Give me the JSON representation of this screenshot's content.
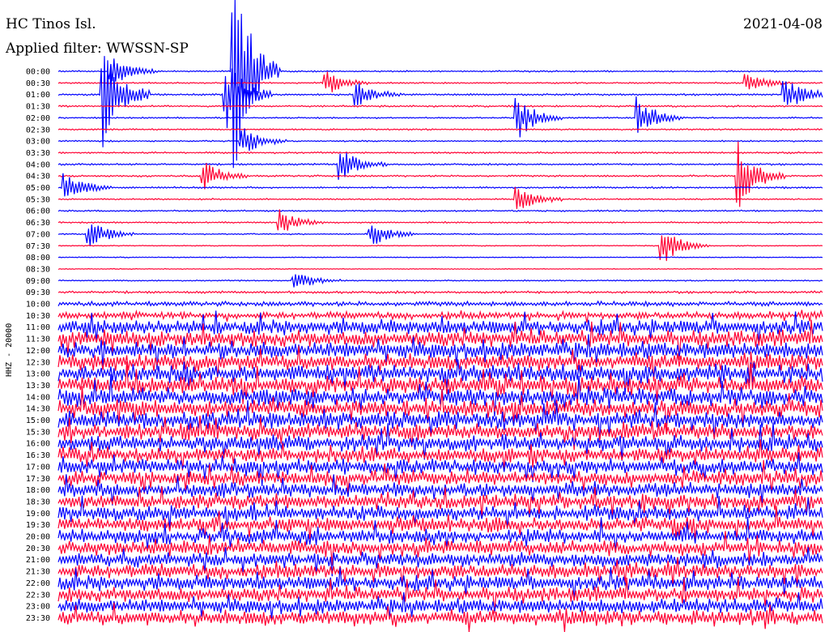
{
  "header": {
    "station": "HC Tinos Isl.",
    "date": "2021-04-08",
    "filter": "Applied filter: WWSSN-SP"
  },
  "chart_data": {
    "type": "line",
    "title": "HC Tinos Isl.",
    "subtitle": "Applied filter: WWSSN-SP",
    "ylabel": "HHZ - 20000",
    "xlabel": "",
    "date": "2021-04-08",
    "colors": [
      "#0000ff",
      "#ff0033"
    ],
    "row_labels": [
      "00:00",
      "00:30",
      "01:00",
      "01:30",
      "02:00",
      "02:30",
      "03:00",
      "03:30",
      "04:00",
      "04:30",
      "05:00",
      "05:30",
      "06:00",
      "06:30",
      "07:00",
      "07:30",
      "08:00",
      "08:30",
      "09:00",
      "09:30",
      "10:00",
      "10:30",
      "11:00",
      "11:30",
      "12:00",
      "12:30",
      "13:00",
      "13:30",
      "14:00",
      "14:30",
      "15:00",
      "15:30",
      "16:00",
      "16:30",
      "17:00",
      "17:30",
      "18:00",
      "18:30",
      "19:00",
      "19:30",
      "20:00",
      "20:30",
      "21:00",
      "21:30",
      "22:00",
      "22:30",
      "23:00",
      "23:30"
    ],
    "noise_level": [
      0.25,
      0.25,
      0.3,
      0.3,
      0.25,
      0.25,
      0.25,
      0.3,
      0.3,
      0.3,
      0.3,
      0.25,
      0.25,
      0.25,
      0.2,
      0.15,
      0.15,
      0.15,
      0.2,
      0.4,
      0.8,
      1.2,
      2.5,
      2.8,
      3.0,
      3.0,
      3.0,
      3.0,
      3.0,
      3.0,
      3.0,
      2.8,
      2.8,
      2.6,
      2.6,
      2.5,
      2.5,
      2.5,
      2.5,
      2.5,
      2.5,
      2.5,
      2.5,
      2.5,
      2.5,
      2.5,
      2.6,
      2.8
    ],
    "events": [
      {
        "row": 0,
        "t": 0.07,
        "amp": 6
      },
      {
        "row": 0,
        "t": 0.23,
        "amp": 40
      },
      {
        "row": 1,
        "t": 0.35,
        "amp": 5
      },
      {
        "row": 1,
        "t": 0.9,
        "amp": 4
      },
      {
        "row": 2,
        "t": 0.06,
        "amp": 22
      },
      {
        "row": 2,
        "t": 0.22,
        "amp": 14
      },
      {
        "row": 2,
        "t": 0.39,
        "amp": 5
      },
      {
        "row": 2,
        "t": 0.95,
        "amp": 9
      },
      {
        "row": 4,
        "t": 0.6,
        "amp": 9
      },
      {
        "row": 4,
        "t": 0.76,
        "amp": 8
      },
      {
        "row": 6,
        "t": 0.24,
        "amp": 6
      },
      {
        "row": 8,
        "t": 0.37,
        "amp": 6
      },
      {
        "row": 9,
        "t": 0.19,
        "amp": 6
      },
      {
        "row": 9,
        "t": 0.89,
        "amp": 14
      },
      {
        "row": 10,
        "t": 0.01,
        "amp": 6
      },
      {
        "row": 11,
        "t": 0.6,
        "amp": 6
      },
      {
        "row": 13,
        "t": 0.29,
        "amp": 5
      },
      {
        "row": 14,
        "t": 0.04,
        "amp": 6
      },
      {
        "row": 14,
        "t": 0.41,
        "amp": 5
      },
      {
        "row": 15,
        "t": 0.79,
        "amp": 8
      },
      {
        "row": 18,
        "t": 0.31,
        "amp": 4
      }
    ]
  }
}
